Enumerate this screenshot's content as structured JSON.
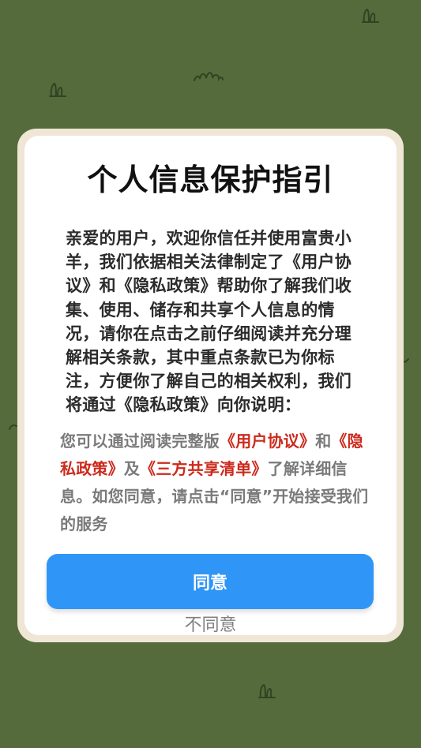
{
  "dialog": {
    "title": "个人信息保护指引",
    "intro": "亲爱的用户，欢迎你信任并使用富贵小羊，我们依据相关法律制定了《用户协议》和《隐私政策》帮助你了解我们收集、使用、储存和共享个人信息的情况，请你在点击之前仔细阅读并充分理解相关条款，其中重点条款已为你标注，方便你了解自己的相关权利，我们将通过《隐私政策》向你说明：",
    "notice": {
      "prefix": "您可以通过阅读完整版",
      "user_agreement_link": "《用户协议》",
      "and": "和",
      "privacy_policy_link": "《隐私政策》",
      "and2": "及",
      "third_party_link": "《三方共享清单》",
      "suffix": "了解详细信息。如您同意，请点击“同意”开始接受我们的服务"
    },
    "agree_label": "同意",
    "disagree_label": "不同意"
  },
  "colors": {
    "background": "#556b3b",
    "dialog_border": "#efe6d6",
    "primary_button": "#2f96f7",
    "link": "#cc2a1c"
  }
}
